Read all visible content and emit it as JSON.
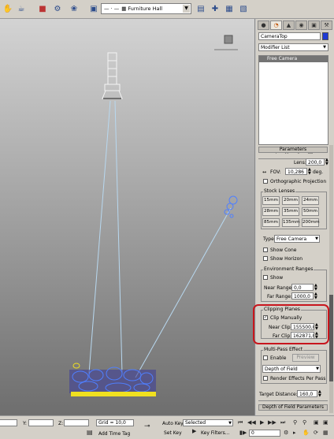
{
  "toolbar": {
    "scene_name": "Furniture Hall",
    "view_mode": "— · —",
    "icons": [
      "pan-icon",
      "teapot-icon",
      "render-setup-icon",
      "render-icon",
      "particle-view-icon",
      "select-icon",
      "snap-icon",
      "layer-icon",
      "copy-icon",
      "add-icon",
      "paste-icon",
      "delete-icon"
    ]
  },
  "panel": {
    "tabs": [
      "create-icon",
      "modify-icon",
      "hierarchy-icon",
      "motion-icon",
      "display-icon",
      "utilities-icon"
    ],
    "object_name": "CameraTop",
    "object_color": "#1f3ad3",
    "modifier_list_label": "Modifier List",
    "stack_items": [
      "Free Camera"
    ],
    "stack_buttons": [
      "⊢",
      "I(",
      "¦¦",
      "◆",
      "▣"
    ],
    "parameters_header": "Parameters",
    "lens_label": "Lens:",
    "lens_value": "200,0",
    "lens_unit": "mm",
    "fov_label": "FOV:",
    "fov_value": "10,286",
    "fov_unit": "deg.",
    "ortho_label": "Orthographic Projection",
    "stock_lenses_title": "Stock Lenses",
    "stock_lenses": [
      "15mm",
      "20mm",
      "24mm",
      "28mm",
      "35mm",
      "50mm",
      "85mm",
      "135mm",
      "200mm"
    ],
    "type_label": "Type:",
    "type_value": "Free Camera",
    "show_cone_label": "Show Cone",
    "show_horizon_label": "Show Horizon",
    "env_ranges_title": "Environment Ranges",
    "env_show_label": "Show",
    "near_range_label": "Near Range:",
    "near_range_value": "0,0",
    "far_range_label": "Far Range:",
    "far_range_value": "1000,0",
    "clipping_title": "Clipping Planes",
    "clip_manually_label": "Clip Manually",
    "clip_manually_checked": "✓",
    "near_clip_label": "Near Clip:",
    "near_clip_value": "155500,0",
    "far_clip_label": "Far Clip:",
    "far_clip_value": "162871,0",
    "multipass_title": "Multi-Pass Effect",
    "enable_label": "Enable",
    "preview_label": "Preview",
    "effect_value": "Depth of Field",
    "render_effects_label": "Render Effects Per Pass",
    "target_distance_label": "Target Distance:",
    "target_distance_value": "160,0",
    "dof_header": "Depth of Field Parameters"
  },
  "statusbar": {
    "x_label": "X:",
    "y_label": "Y:",
    "z_label": "Z:",
    "x_value": "",
    "y_value": "",
    "z_value": "",
    "grid_label": "Grid = 10,0",
    "add_time_tag": "Add Time Tag",
    "auto_key": "Auto Key",
    "selected_value": "Selected",
    "set_key": "Set Key",
    "key_filters": "Key Filters...",
    "frame_value": "0"
  },
  "colors": {
    "highlight": "#c8161d",
    "selection": "#747474",
    "camera_cone": "#b8d8f0",
    "light_blue": "#4f7fff",
    "geometry_yellow": "#f0e020"
  }
}
